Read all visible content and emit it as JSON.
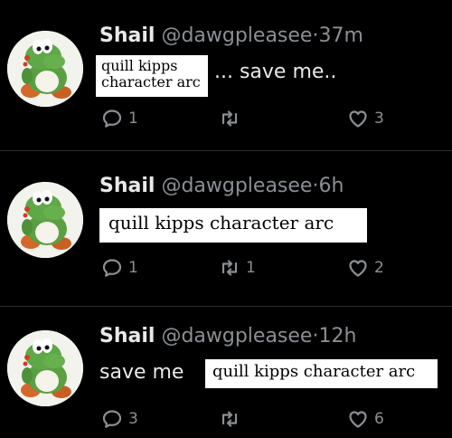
{
  "tweets": [
    {
      "name": "Shail",
      "handle": "@dawgpleasee",
      "separator": "·",
      "time": "37m",
      "text_after": "... save me..",
      "overlay_text": "quill kipps\ncharacter arc",
      "reply_count": "1",
      "retweet_count": "",
      "like_count": "3"
    },
    {
      "name": "Shail",
      "handle": "@dawgpleasee",
      "separator": "·",
      "time": "6h",
      "overlay_text": "quill kipps character arc",
      "reply_count": "1",
      "retweet_count": "1",
      "like_count": "2"
    },
    {
      "name": "Shail",
      "handle": "@dawgpleasee",
      "separator": "·",
      "time": "12h",
      "text_before": "save me",
      "overlay_text": "quill kipps character arc",
      "reply_count": "3",
      "retweet_count": "",
      "like_count": "6"
    }
  ],
  "icons": {
    "reply": "reply-icon",
    "retweet": "retweet-icon",
    "like": "heart-icon",
    "avatar": "yoshi-plush-avatar"
  },
  "colors": {
    "background": "#000000",
    "text": "#e7e9ea",
    "muted": "#8b8f94",
    "overlay": "#ffffff"
  }
}
